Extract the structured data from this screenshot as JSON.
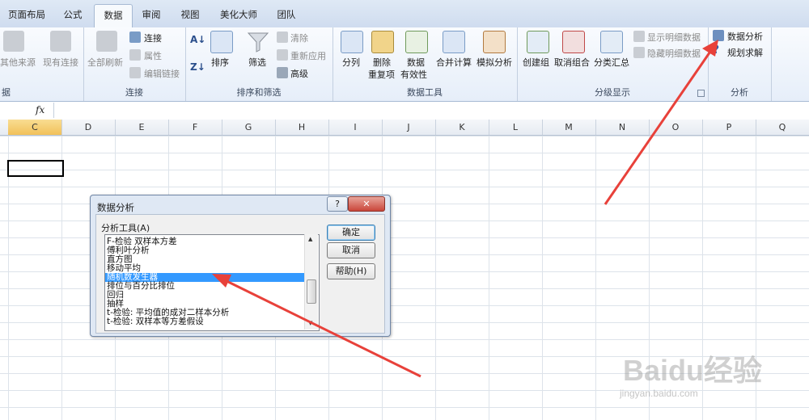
{
  "tabs": [
    {
      "label": "页面布局"
    },
    {
      "label": "公式"
    },
    {
      "label": "数据"
    },
    {
      "label": "审阅"
    },
    {
      "label": "视图"
    },
    {
      "label": "美化大师"
    },
    {
      "label": "团队"
    }
  ],
  "ribbon": {
    "g1": {
      "b1": "其他来源",
      "b2": "现有连接",
      "label": "据"
    },
    "conn": {
      "refresh": "全部刷新",
      "connections": "连接",
      "properties": "属性",
      "edit_links": "编辑链接",
      "label": "连接"
    },
    "sort": {
      "sort": "排序",
      "filter": "筛选",
      "clear": "清除",
      "reapply": "重新应用",
      "advanced": "高级",
      "label": "排序和筛选"
    },
    "tools": {
      "split": "分列",
      "dedupe1": "删除",
      "dedupe2": "重复项",
      "valid1": "数据",
      "valid2": "有效性",
      "consol": "合并计算",
      "whatif": "模拟分析",
      "label": "数据工具"
    },
    "outline": {
      "group": "创建组",
      "ungroup": "取消组合",
      "subtotal": "分类汇总",
      "show": "显示明细数据",
      "hide": "隐藏明细数据",
      "label": "分级显示"
    },
    "analysis": {
      "data_analysis": "数据分析",
      "solver": "规划求解",
      "label": "分析"
    }
  },
  "formula": {
    "fx": "fx"
  },
  "columns": [
    "C",
    "D",
    "E",
    "F",
    "G",
    "H",
    "I",
    "J",
    "K",
    "L",
    "M",
    "N",
    "O",
    "P",
    "Q"
  ],
  "dialog": {
    "title": "数据分析",
    "help_btn": "?",
    "close_btn": "✕",
    "list_label": "分析工具(A)",
    "items": [
      "F-检验 双样本方差",
      "傅利叶分析",
      "直方图",
      "移动平均",
      "随机数发生器",
      "排位与百分比排位",
      "回归",
      "抽样",
      "t-检验: 平均值的成对二样本分析",
      "t-检验: 双样本等方差假设"
    ],
    "selected_index": 4,
    "ok": "确定",
    "cancel": "取消",
    "help": "帮助(H)"
  },
  "watermark": {
    "main": "Baidu经验",
    "sub": "jingyan.baidu.com"
  },
  "colors": {
    "accent_arrow": "#e8413a",
    "selection": "#3399ff"
  }
}
